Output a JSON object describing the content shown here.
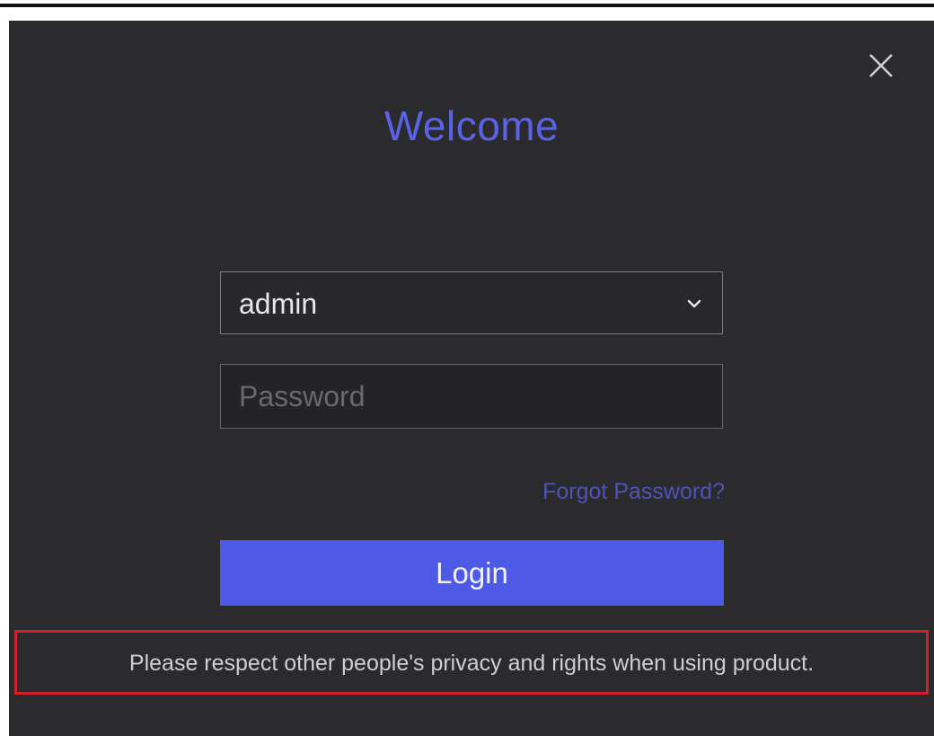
{
  "dialog": {
    "title": "Welcome",
    "close_icon": "close-icon"
  },
  "login_form": {
    "username_value": "admin",
    "username_dropdown_icon": "chevron-down-icon",
    "password_value": "",
    "password_placeholder": "Password",
    "forgot_password_label": "Forgot Password?",
    "login_label": "Login"
  },
  "notice": {
    "text": "Please respect other people's privacy and rights when using product."
  },
  "colors": {
    "background": "#2b2b2e",
    "accent": "#4c5ae6",
    "title": "#5a63e6",
    "link": "#4d53b8",
    "highlight_border": "#d0202a"
  }
}
